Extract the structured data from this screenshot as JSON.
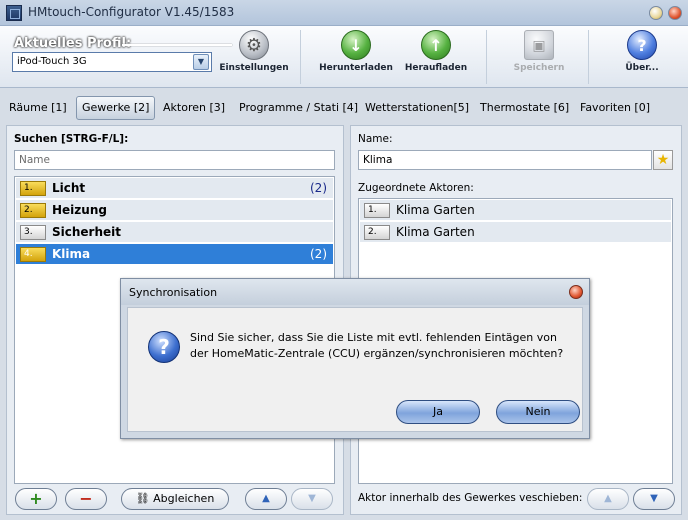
{
  "window": {
    "title": "HMtouch-Configurator V1.45/1583"
  },
  "toolbar": {
    "profile_label": "Aktuelles Profil:",
    "profile_value": "iPod-Touch 3G",
    "settings": "Einstellungen",
    "download": "Herunterladen",
    "upload": "Heraufladen",
    "save": "Speichern",
    "about": "Über...",
    "about_glyph": "?"
  },
  "tabs": [
    "Räume [1]",
    "Gewerke [2]",
    "Aktoren [3]",
    "Programme / Stati [4]",
    "Wetterstationen[5]",
    "Thermostate [6]",
    "Favoriten [0]"
  ],
  "left": {
    "search_label": "Suchen [STRG-F/L]:",
    "search_placeholder": "Name",
    "items": [
      {
        "num": "1.",
        "name": "Licht",
        "count": "(2)"
      },
      {
        "num": "2.",
        "name": "Heizung",
        "count": ""
      },
      {
        "num": "3.",
        "name": "Sicherheit",
        "count": ""
      },
      {
        "num": "4.",
        "name": "Klima",
        "count": "(2)"
      }
    ],
    "add": "+",
    "remove": "−",
    "sync": "Abgleichen"
  },
  "right": {
    "name_label": "Name:",
    "name_value": "Klima",
    "actors_label": "Zugeordnete Aktoren:",
    "actors": [
      {
        "num": "1.",
        "name": "Klima Garten"
      },
      {
        "num": "2.",
        "name": "Klima Garten"
      }
    ],
    "move_label": "Aktor innerhalb des Gewerkes veschieben:"
  },
  "dialog": {
    "title": "Synchronisation",
    "line1": "Sind Sie sicher, dass Sie die Liste mit evtl. fehlenden Eintägen von",
    "line2": "der HomeMatic-Zentrale (CCU) ergänzen/synchronisieren möchten?",
    "yes": "Ja",
    "no": "Nein",
    "icon": "?"
  },
  "colors": {
    "selection": "#2f7fd8",
    "accent_blue": "#3d6fcf",
    "green": "#55b140"
  }
}
